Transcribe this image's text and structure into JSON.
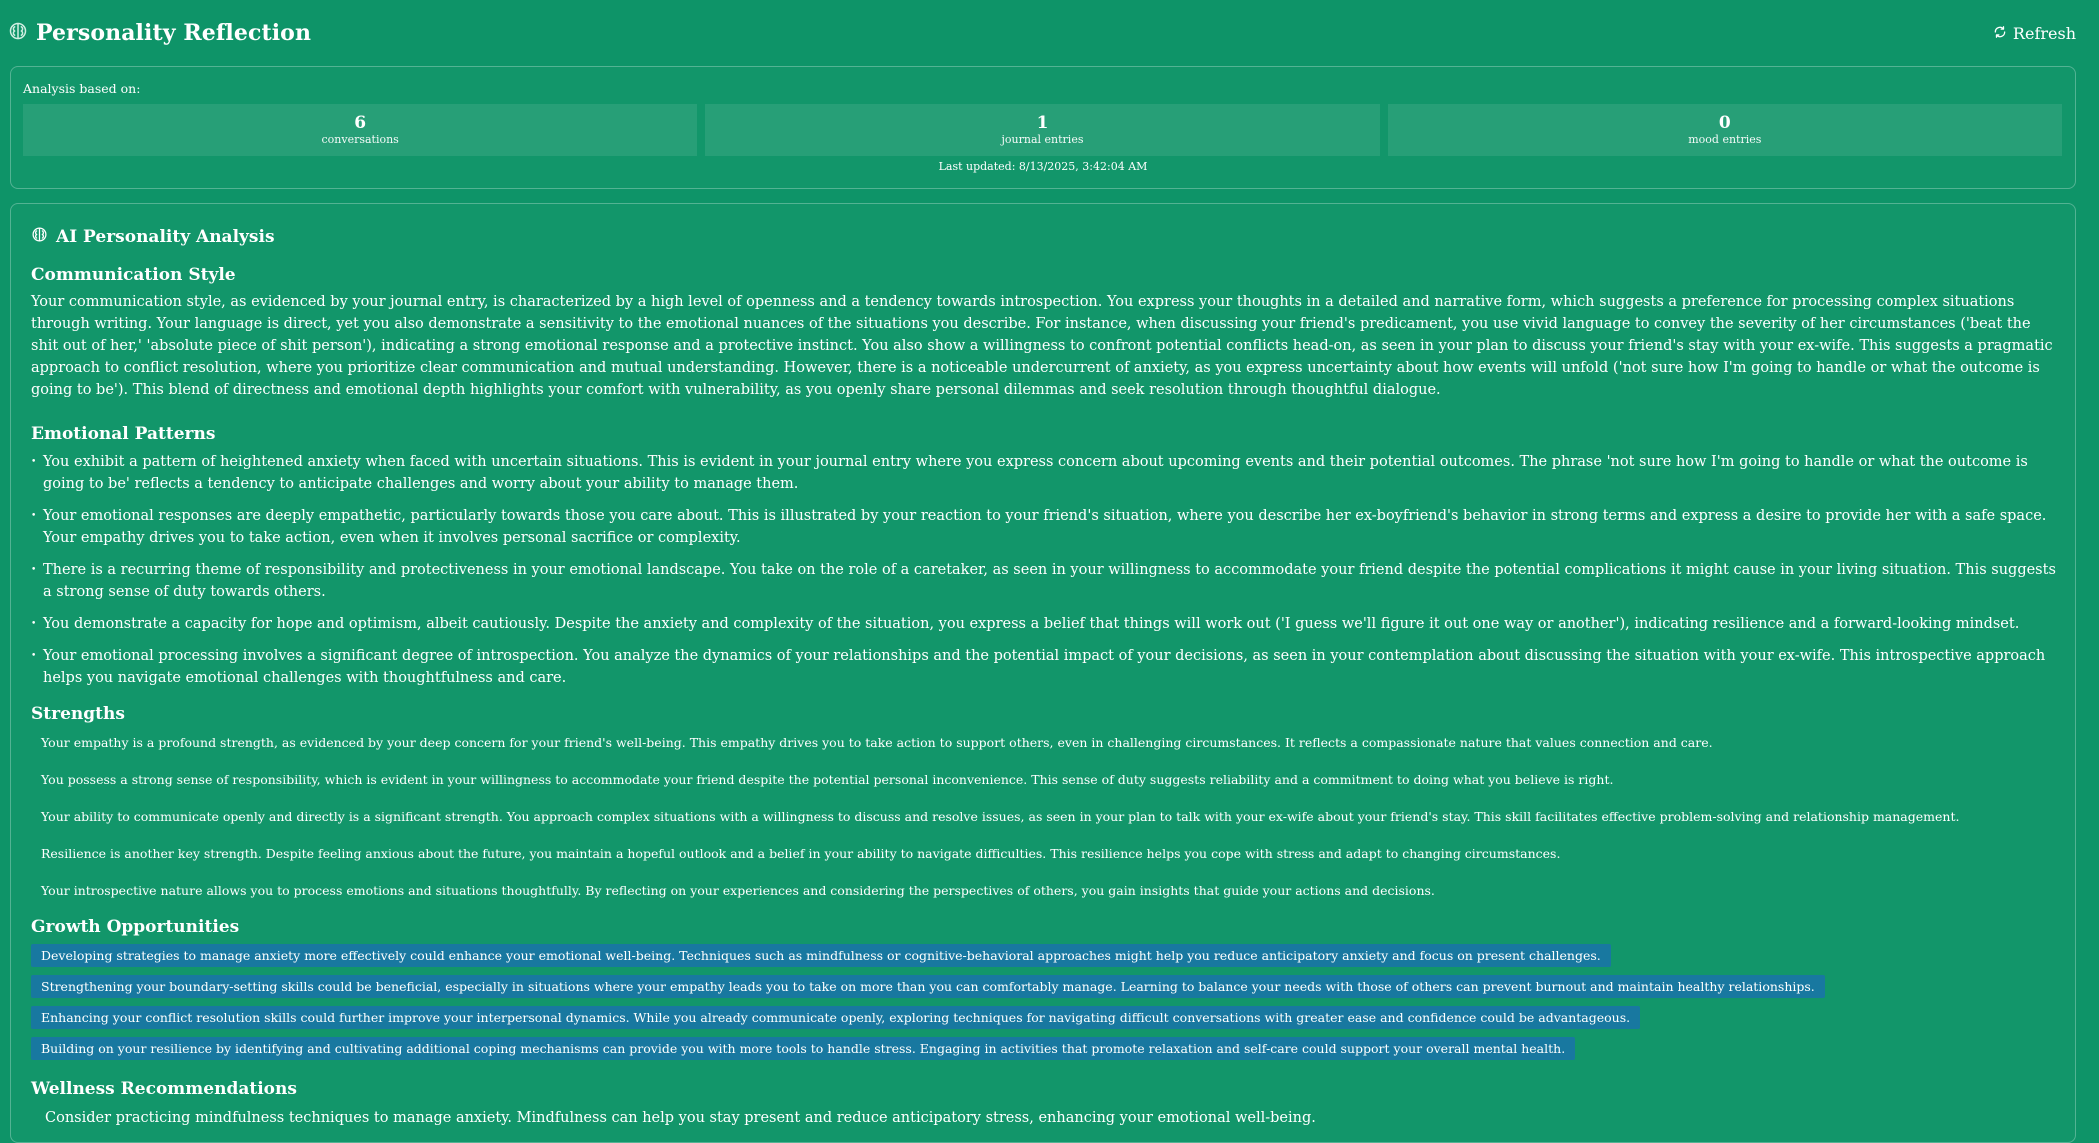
{
  "header": {
    "title": "Personality Reflection",
    "refresh_label": "Refresh"
  },
  "stats": {
    "label": "Analysis based on:",
    "items": [
      {
        "value": "6",
        "label": "conversations"
      },
      {
        "value": "1",
        "label": "journal entries"
      },
      {
        "value": "0",
        "label": "mood entries"
      }
    ],
    "last_updated": "Last updated: 8/13/2025, 3:42:04 AM"
  },
  "analysis": {
    "title": "AI Personality Analysis",
    "communication": {
      "title": "Communication Style",
      "text": "Your communication style, as evidenced by your journal entry, is characterized by a high level of openness and a tendency towards introspection. You express your thoughts in a detailed and narrative form, which suggests a preference for processing complex situations through writing. Your language is direct, yet you also demonstrate a sensitivity to the emotional nuances of the situations you describe. For instance, when discussing your friend's predicament, you use vivid language to convey the severity of her circumstances ('beat the shit out of her,' 'absolute piece of shit person'), indicating a strong emotional response and a protective instinct. You also show a willingness to confront potential conflicts head-on, as seen in your plan to discuss your friend's stay with your ex-wife. This suggests a pragmatic approach to conflict resolution, where you prioritize clear communication and mutual understanding. However, there is a noticeable undercurrent of anxiety, as you express uncertainty about how events will unfold ('not sure how I'm going to handle or what the outcome is going to be'). This blend of directness and emotional depth highlights your comfort with vulnerability, as you openly share personal dilemmas and seek resolution through thoughtful dialogue."
    },
    "emotional": {
      "title": "Emotional Patterns",
      "items": [
        "You exhibit a pattern of heightened anxiety when faced with uncertain situations. This is evident in your journal entry where you express concern about upcoming events and their potential outcomes. The phrase 'not sure how I'm going to handle or what the outcome is going to be' reflects a tendency to anticipate challenges and worry about your ability to manage them.",
        "Your emotional responses are deeply empathetic, particularly towards those you care about. This is illustrated by your reaction to your friend's situation, where you describe her ex-boyfriend's behavior in strong terms and express a desire to provide her with a safe space. Your empathy drives you to take action, even when it involves personal sacrifice or complexity.",
        "There is a recurring theme of responsibility and protectiveness in your emotional landscape. You take on the role of a caretaker, as seen in your willingness to accommodate your friend despite the potential complications it might cause in your living situation. This suggests a strong sense of duty towards others.",
        "You demonstrate a capacity for hope and optimism, albeit cautiously. Despite the anxiety and complexity of the situation, you express a belief that things will work out ('I guess we'll figure it out one way or another'), indicating resilience and a forward-looking mindset.",
        "Your emotional processing involves a significant degree of introspection. You analyze the dynamics of your relationships and the potential impact of your decisions, as seen in your contemplation about discussing the situation with your ex-wife. This introspective approach helps you navigate emotional challenges with thoughtfulness and care."
      ]
    },
    "strengths": {
      "title": "Strengths",
      "items": [
        "Your empathy is a profound strength, as evidenced by your deep concern for your friend's well-being. This empathy drives you to take action to support others, even in challenging circumstances. It reflects a compassionate nature that values connection and care.",
        "You possess a strong sense of responsibility, which is evident in your willingness to accommodate your friend despite the potential personal inconvenience. This sense of duty suggests reliability and a commitment to doing what you believe is right.",
        "Your ability to communicate openly and directly is a significant strength. You approach complex situations with a willingness to discuss and resolve issues, as seen in your plan to talk with your ex-wife about your friend's stay. This skill facilitates effective problem-solving and relationship management.",
        "Resilience is another key strength. Despite feeling anxious about the future, you maintain a hopeful outlook and a belief in your ability to navigate difficulties. This resilience helps you cope with stress and adapt to changing circumstances.",
        "Your introspective nature allows you to process emotions and situations thoughtfully. By reflecting on your experiences and considering the perspectives of others, you gain insights that guide your actions and decisions."
      ]
    },
    "growth": {
      "title": "Growth Opportunities",
      "items": [
        "Developing strategies to manage anxiety more effectively could enhance your emotional well-being. Techniques such as mindfulness or cognitive-behavioral approaches might help you reduce anticipatory anxiety and focus on present challenges.",
        "Strengthening your boundary-setting skills could be beneficial, especially in situations where your empathy leads you to take on more than you can comfortably manage. Learning to balance your needs with those of others can prevent burnout and maintain healthy relationships.",
        "Enhancing your conflict resolution skills could further improve your interpersonal dynamics. While you already communicate openly, exploring techniques for navigating difficult conversations with greater ease and confidence could be advantageous.",
        "Building on your resilience by identifying and cultivating additional coping mechanisms can provide you with more tools to handle stress. Engaging in activities that promote relaxation and self-care could support your overall mental health."
      ]
    },
    "wellness": {
      "title": "Wellness Recommendations",
      "items": [
        "Consider practicing mindfulness techniques to manage anxiety. Mindfulness can help you stay present and reduce anticipatory stress, enhancing your emotional well-being."
      ]
    }
  }
}
